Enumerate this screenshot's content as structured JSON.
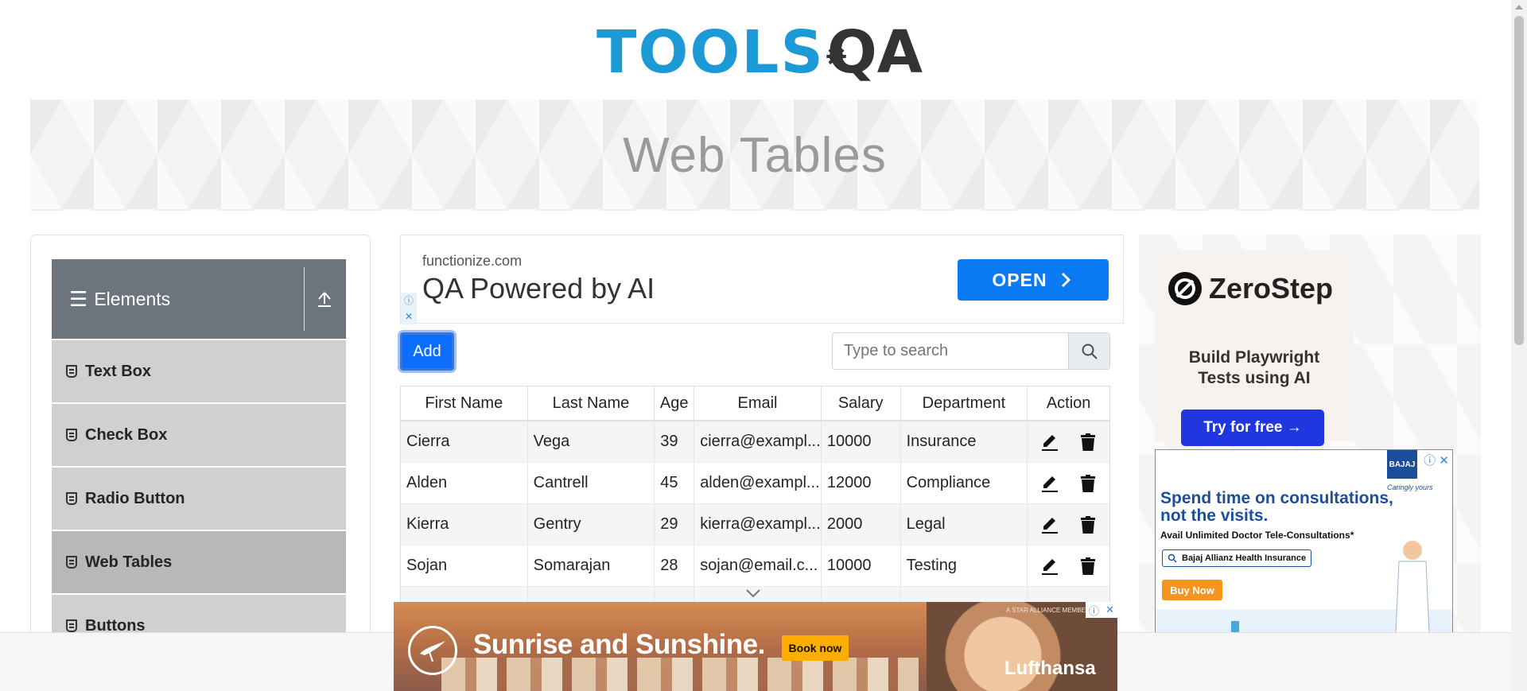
{
  "header": {
    "logo_tools": "TOOLS",
    "logo_qa": "QA",
    "page_title": "Web Tables"
  },
  "sidebar": {
    "group_title": "Elements",
    "items": [
      {
        "label": "Text Box",
        "active": false
      },
      {
        "label": "Check Box",
        "active": false
      },
      {
        "label": "Radio Button",
        "active": false
      },
      {
        "label": "Web Tables",
        "active": true
      },
      {
        "label": "Buttons",
        "active": false
      }
    ]
  },
  "ad_top": {
    "domain": "functionize.com",
    "headline": "QA Powered by AI",
    "cta": "OPEN"
  },
  "toolbar": {
    "add_label": "Add",
    "search_placeholder": "Type to search"
  },
  "table": {
    "columns": [
      "First Name",
      "Last Name",
      "Age",
      "Email",
      "Salary",
      "Department",
      "Action"
    ],
    "rows": [
      {
        "first": "Cierra",
        "last": "Vega",
        "age": "39",
        "email": "cierra@exampl...",
        "salary": "10000",
        "dept": "Insurance"
      },
      {
        "first": "Alden",
        "last": "Cantrell",
        "age": "45",
        "email": "alden@exampl...",
        "salary": "12000",
        "dept": "Compliance"
      },
      {
        "first": "Kierra",
        "last": "Gentry",
        "age": "29",
        "email": "kierra@exampl...",
        "salary": "2000",
        "dept": "Legal"
      },
      {
        "first": "Sojan",
        "last": "Somarajan",
        "age": "28",
        "email": "sojan@email.c...",
        "salary": "10000",
        "dept": "Testing"
      }
    ]
  },
  "ad_right": {
    "brand": "ZeroStep",
    "tagline_line1": "Build Playwright",
    "tagline_line2": "Tests using AI",
    "cta": "Try for free →"
  },
  "ad_bajaj": {
    "logo": "BAJAJ",
    "logo_tagline": "Caringly yours",
    "headline": "Spend time on consultations, not the visits.",
    "sub": "Avail Unlimited Doctor Tele-Consultations*",
    "search_text": "Bajaj Allianz Health Insurance",
    "cta": "Buy Now"
  },
  "ad_bottom": {
    "slogan": "Sunrise and Sunshine.",
    "cta": "Book now",
    "brand": "Lufthansa",
    "member_note": "A STAR ALLIANCE MEMBER"
  },
  "colors": {
    "primary": "#0d6efd",
    "sidebar_header": "#6c757d",
    "menu_item": "#d0d0d0",
    "logo_blue": "#1c9ad6"
  }
}
